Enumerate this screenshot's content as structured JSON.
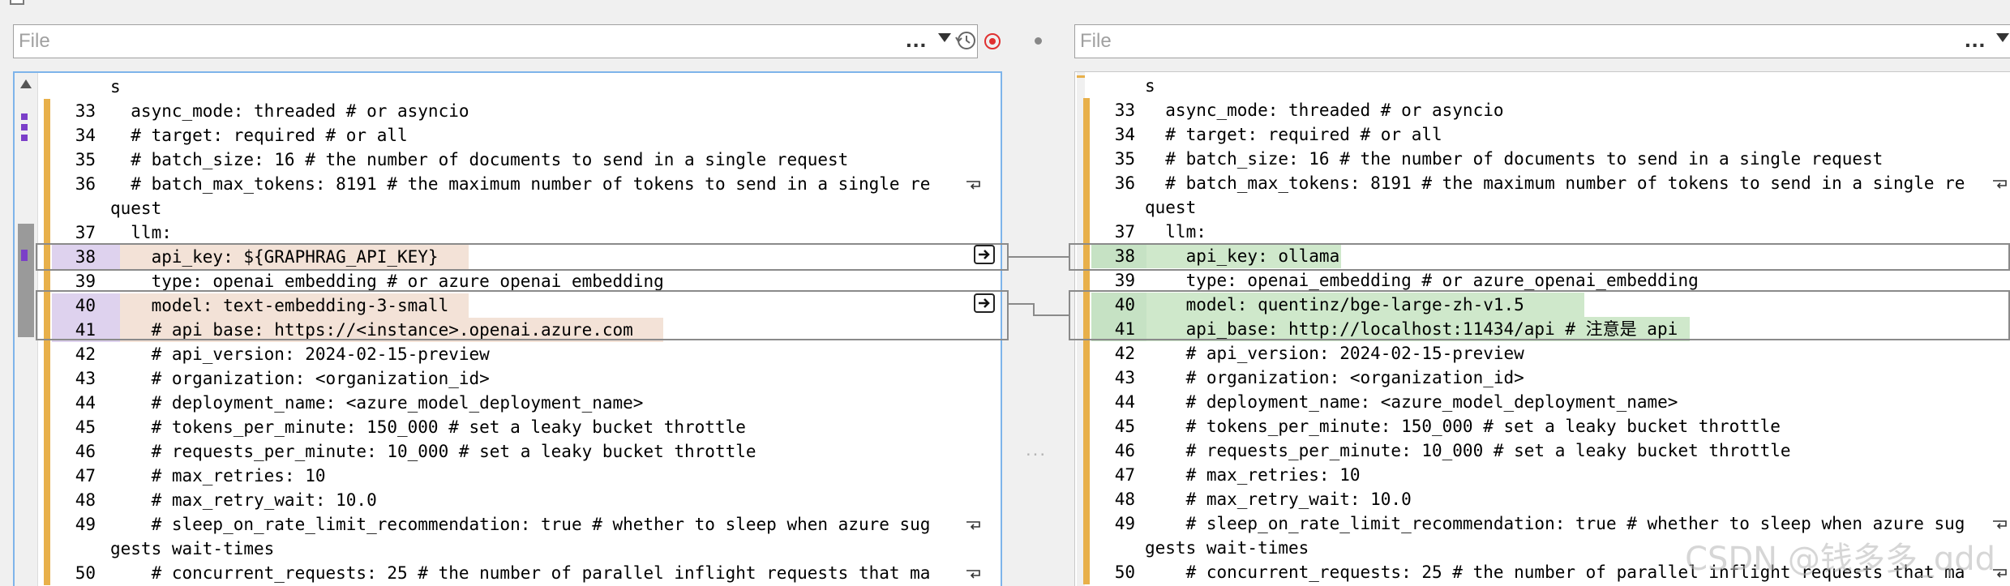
{
  "left_file": {
    "placeholder": "File",
    "more_label": "...",
    "history_icon": "history-icon",
    "stop_icon": "stop-icon"
  },
  "right_file": {
    "placeholder": "File",
    "more_label": "..."
  },
  "middle": {
    "ellipsis": "..."
  },
  "colors": {
    "change_bar": "#e8b04a",
    "left_changed": "#f3e2d7",
    "right_changed": "#cfe8cb",
    "accent_border": "#7eb4ea",
    "marker": "#7b3fc8"
  },
  "left": {
    "lines": [
      {
        "num": "",
        "text": "s"
      },
      {
        "num": "33",
        "text": "  async_mode: threaded # or asyncio"
      },
      {
        "num": "34",
        "text": "  # target: required # or all"
      },
      {
        "num": "35",
        "text": "  # batch_size: 16 # the number of documents to send in a single request"
      },
      {
        "num": "36",
        "text": "  # batch_max_tokens: 8191 # the maximum number of tokens to send in a single re"
      },
      {
        "num": "",
        "text": "quest"
      },
      {
        "num": "37",
        "text": "  llm:"
      },
      {
        "num": "38",
        "text": "    api_key: ${GRAPHRAG_API_KEY}"
      },
      {
        "num": "39",
        "text": "    type: openai_embedding # or azure_openai_embedding"
      },
      {
        "num": "40",
        "text": "    model: text-embedding-3-small"
      },
      {
        "num": "41",
        "text": "    # api_base: https://<instance>.openai.azure.com"
      },
      {
        "num": "42",
        "text": "    # api_version: 2024-02-15-preview"
      },
      {
        "num": "43",
        "text": "    # organization: <organization_id>"
      },
      {
        "num": "44",
        "text": "    # deployment_name: <azure_model_deployment_name>"
      },
      {
        "num": "45",
        "text": "    # tokens_per_minute: 150_000 # set a leaky bucket throttle"
      },
      {
        "num": "46",
        "text": "    # requests_per_minute: 10_000 # set a leaky bucket throttle"
      },
      {
        "num": "47",
        "text": "    # max_retries: 10"
      },
      {
        "num": "48",
        "text": "    # max_retry_wait: 10.0"
      },
      {
        "num": "49",
        "text": "    # sleep_on_rate_limit_recommendation: true # whether to sleep when azure sug"
      },
      {
        "num": "",
        "text": "gests wait-times"
      },
      {
        "num": "50",
        "text": "    # concurrent_requests: 25 # the number of parallel inflight requests that ma"
      }
    ]
  },
  "right": {
    "lines": [
      {
        "num": "",
        "text": "s"
      },
      {
        "num": "33",
        "text": "  async_mode: threaded # or asyncio"
      },
      {
        "num": "34",
        "text": "  # target: required # or all"
      },
      {
        "num": "35",
        "text": "  # batch_size: 16 # the number of documents to send in a single request"
      },
      {
        "num": "36",
        "text": "  # batch_max_tokens: 8191 # the maximum number of tokens to send in a single re"
      },
      {
        "num": "",
        "text": "quest"
      },
      {
        "num": "37",
        "text": "  llm:"
      },
      {
        "num": "38",
        "text": "    api_key: ollama"
      },
      {
        "num": "39",
        "text": "    type: openai_embedding # or azure_openai_embedding"
      },
      {
        "num": "40",
        "text": "    model: quentinz/bge-large-zh-v1.5"
      },
      {
        "num": "41",
        "text": "    api_base: http://localhost:11434/api # 注意是 api"
      },
      {
        "num": "42",
        "text": "    # api_version: 2024-02-15-preview"
      },
      {
        "num": "43",
        "text": "    # organization: <organization_id>"
      },
      {
        "num": "44",
        "text": "    # deployment_name: <azure_model_deployment_name>"
      },
      {
        "num": "45",
        "text": "    # tokens_per_minute: 150_000 # set a leaky bucket throttle"
      },
      {
        "num": "46",
        "text": "    # requests_per_minute: 10_000 # set a leaky bucket throttle"
      },
      {
        "num": "47",
        "text": "    # max_retries: 10"
      },
      {
        "num": "48",
        "text": "    # max_retry_wait: 10.0"
      },
      {
        "num": "49",
        "text": "    # sleep_on_rate_limit_recommendation: true # whether to sleep when azure sug"
      },
      {
        "num": "",
        "text": "gests wait-times"
      },
      {
        "num": "50",
        "text": "    # concurrent_requests: 25 # the number of parallel inflight requests that ma"
      }
    ]
  },
  "watermark": "CSDN @钱多多_qdd"
}
